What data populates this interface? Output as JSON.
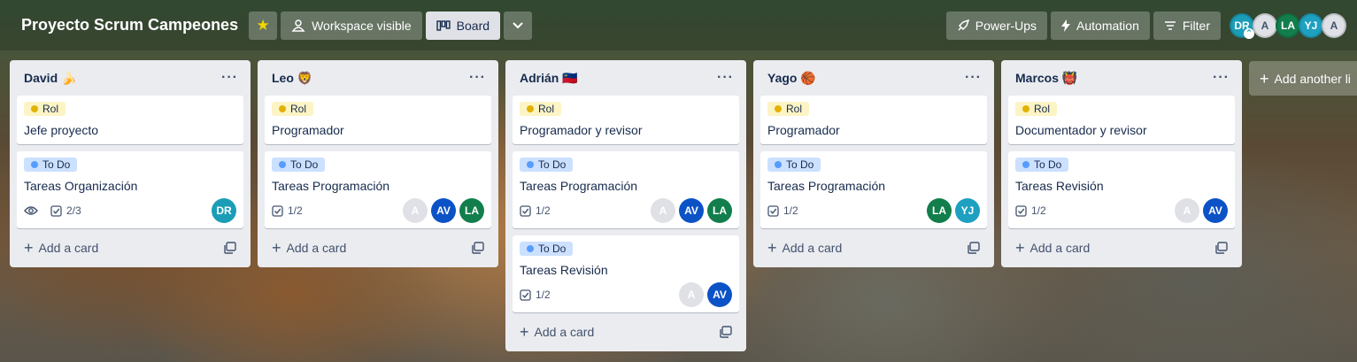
{
  "header": {
    "board_title": "Proyecto Scrum Campeones",
    "visibility_label": "Workspace visible",
    "view_label": "Board",
    "powerups_label": "Power-Ups",
    "automation_label": "Automation",
    "filter_label": "Filter",
    "members": [
      "DR",
      "A",
      "LA",
      "YJ",
      "A"
    ]
  },
  "lists": [
    {
      "title": "David 🍌",
      "cards": [
        {
          "label": "Rol",
          "title": "Jefe proyecto"
        },
        {
          "label": "To Do",
          "title": "Tareas Organización",
          "checklist": "2/3",
          "members": [
            "DR"
          ]
        }
      ],
      "add_label": "Add a card"
    },
    {
      "title": "Leo 🦁",
      "cards": [
        {
          "label": "Rol",
          "title": "Programador"
        },
        {
          "label": "To Do",
          "title": "Tareas Programación",
          "checklist": "1/2",
          "members": [
            "A",
            "AV",
            "LA"
          ]
        }
      ],
      "add_label": "Add a card"
    },
    {
      "title": "Adrián 🇱🇮",
      "cards": [
        {
          "label": "Rol",
          "title": "Programador y revisor"
        },
        {
          "label": "To Do",
          "title": "Tareas Programación",
          "checklist": "1/2",
          "members": [
            "A",
            "AV",
            "LA"
          ]
        },
        {
          "label": "To Do",
          "title": "Tareas Revisión",
          "checklist": "1/2",
          "members": [
            "A",
            "AV"
          ]
        }
      ],
      "add_label": "Add a card"
    },
    {
      "title": "Yago 🏀",
      "cards": [
        {
          "label": "Rol",
          "title": "Programador"
        },
        {
          "label": "To Do",
          "title": "Tareas Programación",
          "checklist": "1/2",
          "members": [
            "LA",
            "YJ"
          ]
        }
      ],
      "add_label": "Add a card"
    },
    {
      "title": "Marcos 👹",
      "cards": [
        {
          "label": "Rol",
          "title": "Documentador y revisor"
        },
        {
          "label": "To Do",
          "title": "Tareas Revisión",
          "checklist": "1/2",
          "members": [
            "A",
            "AV"
          ]
        }
      ],
      "add_label": "Add a card"
    }
  ],
  "add_list_label": "Add another li",
  "colors": {
    "label_rol": "#fdf4c5",
    "label_todo": "#cce0ff",
    "avatar_av": "#0c52c7",
    "avatar_la": "#127e4c",
    "avatar_yj": "#1ea0c0",
    "avatar_dr": "#1b9db8"
  }
}
